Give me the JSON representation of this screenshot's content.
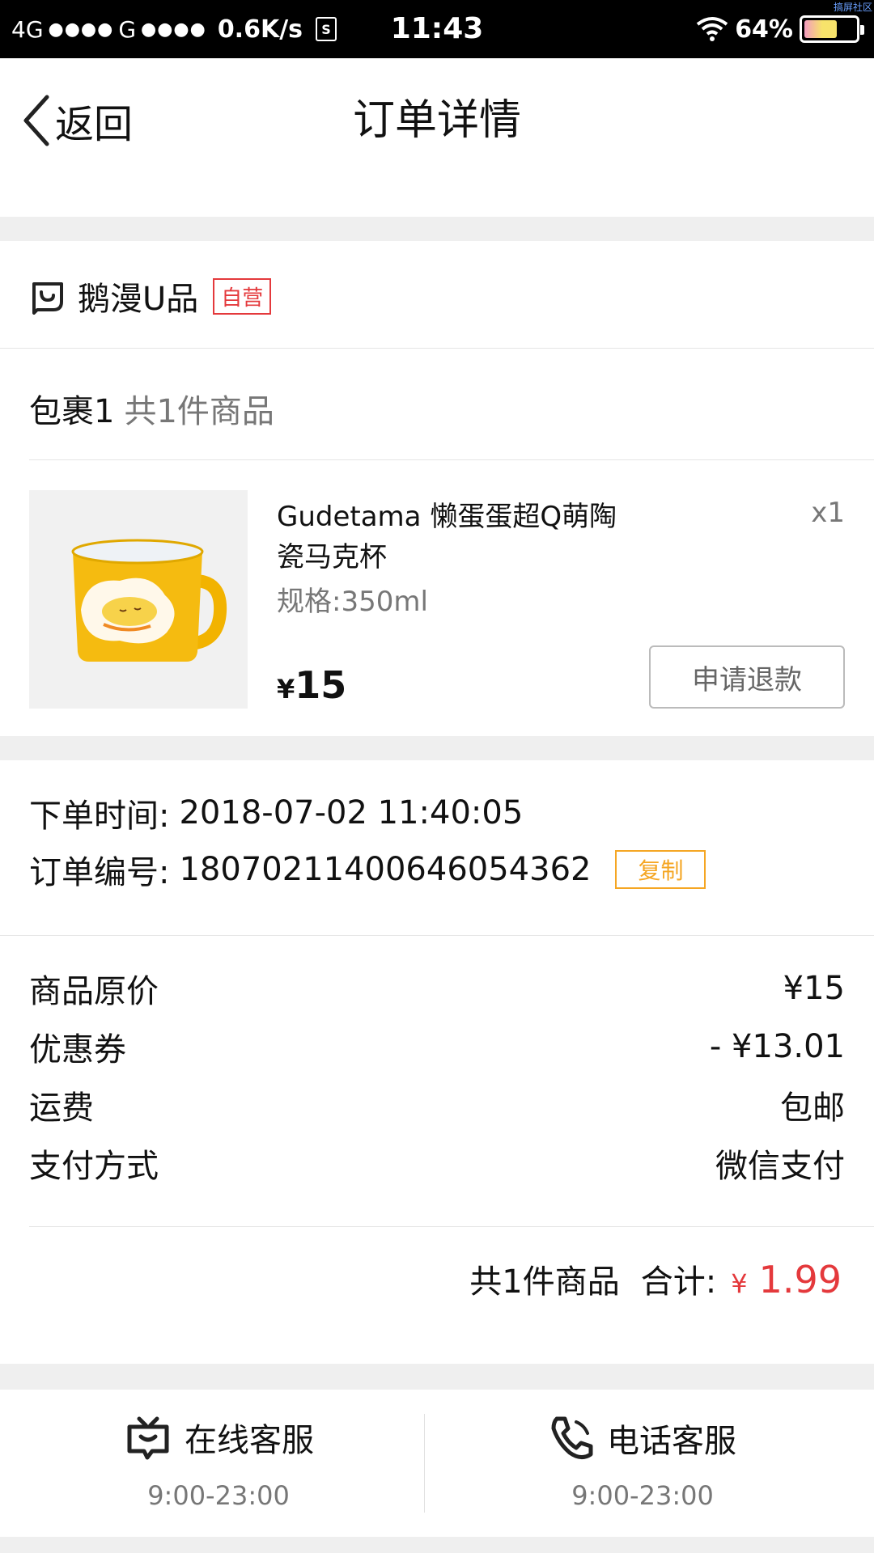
{
  "status_bar": {
    "network": "4G",
    "signal1": "●●●●",
    "network2": "G",
    "signal2": "●●●●",
    "speed": "0.6K/s",
    "sim": "S",
    "time": "11:43",
    "battery": "64%",
    "battery_level": 0.64,
    "corner_text": "搞屏社区"
  },
  "header": {
    "back_label": "返回",
    "title": "订单详情"
  },
  "shop": {
    "name": "鹅漫U品",
    "tag": "自营",
    "package_label": "包裹1",
    "package_count": "共1件商品"
  },
  "product": {
    "name": "Gudetama 懒蛋蛋超Q萌陶瓷马克杯",
    "quantity": "x1",
    "spec": "规格:350ml",
    "currency": "¥",
    "price": "15",
    "refund_button": "申请退款"
  },
  "order": {
    "time_label": "下单时间:",
    "time_value": "2018-07-02 11:40:05",
    "number_label": "订单编号:",
    "number_value": "180702114006460543 62",
    "copy_button": "复制"
  },
  "fees": [
    {
      "label": "商品原价",
      "value": "¥15"
    },
    {
      "label": "优惠券",
      "value": "- ¥13.01"
    },
    {
      "label": "运费",
      "value": "包邮"
    },
    {
      "label": "支付方式",
      "value": "微信支付"
    }
  ],
  "total": {
    "count": "共1件商品",
    "label": "合计:",
    "currency": "¥",
    "amount": "1.99"
  },
  "service": {
    "online_label": "在线客服",
    "online_hours": "9:00-23:00",
    "phone_label": "电话客服",
    "phone_hours": "9:00-23:00"
  },
  "colors": {
    "accent_red": "#e4393c",
    "copy_orange": "#f5a623"
  }
}
